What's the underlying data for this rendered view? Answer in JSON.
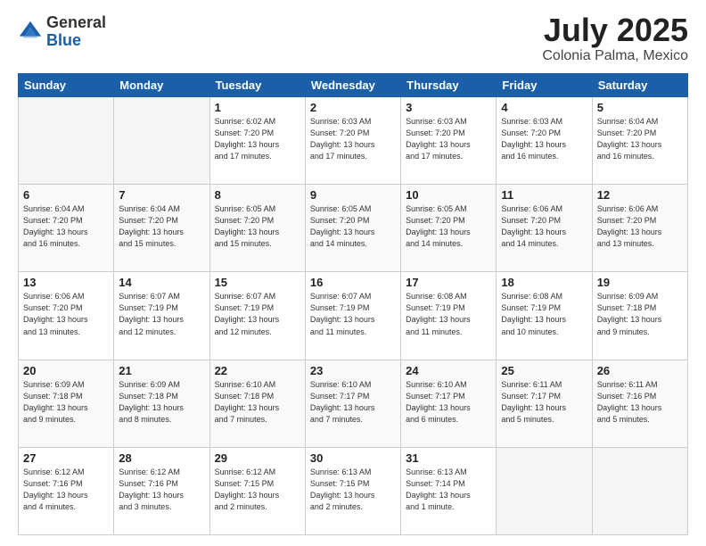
{
  "header": {
    "logo_general": "General",
    "logo_blue": "Blue",
    "month_year": "July 2025",
    "location": "Colonia Palma, Mexico"
  },
  "days_of_week": [
    "Sunday",
    "Monday",
    "Tuesday",
    "Wednesday",
    "Thursday",
    "Friday",
    "Saturday"
  ],
  "weeks": [
    [
      {
        "day": "",
        "info": ""
      },
      {
        "day": "",
        "info": ""
      },
      {
        "day": "1",
        "info": "Sunrise: 6:02 AM\nSunset: 7:20 PM\nDaylight: 13 hours\nand 17 minutes."
      },
      {
        "day": "2",
        "info": "Sunrise: 6:03 AM\nSunset: 7:20 PM\nDaylight: 13 hours\nand 17 minutes."
      },
      {
        "day": "3",
        "info": "Sunrise: 6:03 AM\nSunset: 7:20 PM\nDaylight: 13 hours\nand 17 minutes."
      },
      {
        "day": "4",
        "info": "Sunrise: 6:03 AM\nSunset: 7:20 PM\nDaylight: 13 hours\nand 16 minutes."
      },
      {
        "day": "5",
        "info": "Sunrise: 6:04 AM\nSunset: 7:20 PM\nDaylight: 13 hours\nand 16 minutes."
      }
    ],
    [
      {
        "day": "6",
        "info": "Sunrise: 6:04 AM\nSunset: 7:20 PM\nDaylight: 13 hours\nand 16 minutes."
      },
      {
        "day": "7",
        "info": "Sunrise: 6:04 AM\nSunset: 7:20 PM\nDaylight: 13 hours\nand 15 minutes."
      },
      {
        "day": "8",
        "info": "Sunrise: 6:05 AM\nSunset: 7:20 PM\nDaylight: 13 hours\nand 15 minutes."
      },
      {
        "day": "9",
        "info": "Sunrise: 6:05 AM\nSunset: 7:20 PM\nDaylight: 13 hours\nand 14 minutes."
      },
      {
        "day": "10",
        "info": "Sunrise: 6:05 AM\nSunset: 7:20 PM\nDaylight: 13 hours\nand 14 minutes."
      },
      {
        "day": "11",
        "info": "Sunrise: 6:06 AM\nSunset: 7:20 PM\nDaylight: 13 hours\nand 14 minutes."
      },
      {
        "day": "12",
        "info": "Sunrise: 6:06 AM\nSunset: 7:20 PM\nDaylight: 13 hours\nand 13 minutes."
      }
    ],
    [
      {
        "day": "13",
        "info": "Sunrise: 6:06 AM\nSunset: 7:20 PM\nDaylight: 13 hours\nand 13 minutes."
      },
      {
        "day": "14",
        "info": "Sunrise: 6:07 AM\nSunset: 7:19 PM\nDaylight: 13 hours\nand 12 minutes."
      },
      {
        "day": "15",
        "info": "Sunrise: 6:07 AM\nSunset: 7:19 PM\nDaylight: 13 hours\nand 12 minutes."
      },
      {
        "day": "16",
        "info": "Sunrise: 6:07 AM\nSunset: 7:19 PM\nDaylight: 13 hours\nand 11 minutes."
      },
      {
        "day": "17",
        "info": "Sunrise: 6:08 AM\nSunset: 7:19 PM\nDaylight: 13 hours\nand 11 minutes."
      },
      {
        "day": "18",
        "info": "Sunrise: 6:08 AM\nSunset: 7:19 PM\nDaylight: 13 hours\nand 10 minutes."
      },
      {
        "day": "19",
        "info": "Sunrise: 6:09 AM\nSunset: 7:18 PM\nDaylight: 13 hours\nand 9 minutes."
      }
    ],
    [
      {
        "day": "20",
        "info": "Sunrise: 6:09 AM\nSunset: 7:18 PM\nDaylight: 13 hours\nand 9 minutes."
      },
      {
        "day": "21",
        "info": "Sunrise: 6:09 AM\nSunset: 7:18 PM\nDaylight: 13 hours\nand 8 minutes."
      },
      {
        "day": "22",
        "info": "Sunrise: 6:10 AM\nSunset: 7:18 PM\nDaylight: 13 hours\nand 7 minutes."
      },
      {
        "day": "23",
        "info": "Sunrise: 6:10 AM\nSunset: 7:17 PM\nDaylight: 13 hours\nand 7 minutes."
      },
      {
        "day": "24",
        "info": "Sunrise: 6:10 AM\nSunset: 7:17 PM\nDaylight: 13 hours\nand 6 minutes."
      },
      {
        "day": "25",
        "info": "Sunrise: 6:11 AM\nSunset: 7:17 PM\nDaylight: 13 hours\nand 5 minutes."
      },
      {
        "day": "26",
        "info": "Sunrise: 6:11 AM\nSunset: 7:16 PM\nDaylight: 13 hours\nand 5 minutes."
      }
    ],
    [
      {
        "day": "27",
        "info": "Sunrise: 6:12 AM\nSunset: 7:16 PM\nDaylight: 13 hours\nand 4 minutes."
      },
      {
        "day": "28",
        "info": "Sunrise: 6:12 AM\nSunset: 7:16 PM\nDaylight: 13 hours\nand 3 minutes."
      },
      {
        "day": "29",
        "info": "Sunrise: 6:12 AM\nSunset: 7:15 PM\nDaylight: 13 hours\nand 2 minutes."
      },
      {
        "day": "30",
        "info": "Sunrise: 6:13 AM\nSunset: 7:15 PM\nDaylight: 13 hours\nand 2 minutes."
      },
      {
        "day": "31",
        "info": "Sunrise: 6:13 AM\nSunset: 7:14 PM\nDaylight: 13 hours\nand 1 minute."
      },
      {
        "day": "",
        "info": ""
      },
      {
        "day": "",
        "info": ""
      }
    ]
  ]
}
